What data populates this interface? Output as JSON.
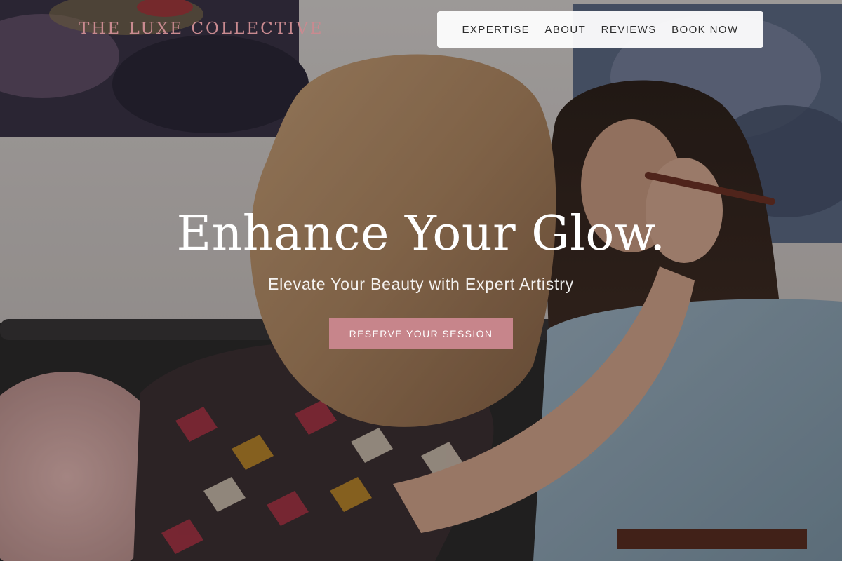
{
  "brand": {
    "name": "THE LUXE COLLECTIVE"
  },
  "nav": {
    "items": [
      {
        "label": "EXPERTISE"
      },
      {
        "label": "ABOUT"
      },
      {
        "label": "REVIEWS"
      },
      {
        "label": "BOOK NOW"
      }
    ]
  },
  "hero": {
    "headline": "Enhance Your Glow.",
    "subheadline": "Elevate Your Beauty with Expert Artistry",
    "cta_label": "RESERVE YOUR SESSION"
  },
  "colors": {
    "brand_pink": "#c98a90",
    "cta_background": "#c7858b",
    "nav_background": "#ffffff",
    "headline_text": "#ffffff"
  },
  "background_image": "makeup-application-photo"
}
